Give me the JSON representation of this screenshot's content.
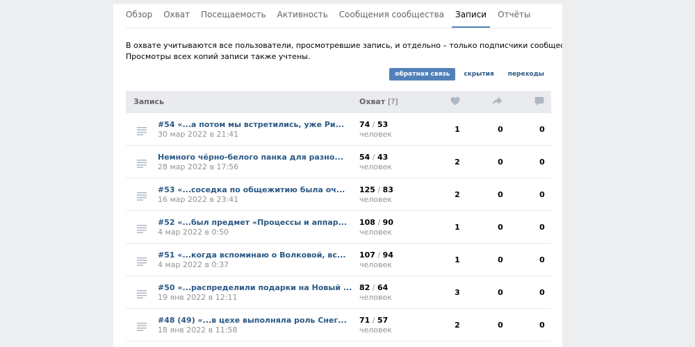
{
  "tabs": [
    {
      "label": "Обзор",
      "active": false
    },
    {
      "label": "Охват",
      "active": false
    },
    {
      "label": "Посещаемость",
      "active": false
    },
    {
      "label": "Активность",
      "active": false
    },
    {
      "label": "Сообщения сообщества",
      "active": false
    },
    {
      "label": "Записи",
      "active": true
    },
    {
      "label": "Отчёты",
      "active": false
    }
  ],
  "info": {
    "line1": "В охвате учитываются все пользователи, просмотревшие запись, и отдельно – только подписчики сообщества.",
    "line2": "Просмотры всех копий записи также учтены."
  },
  "switch": {
    "feedback": "обратная связь",
    "hides": "скрытия",
    "clicks": "переходы",
    "active": "feedback"
  },
  "table": {
    "col_post": "Запись",
    "col_reach": "Охват",
    "col_reach_hint": "[?]",
    "icons": [
      "heart-icon",
      "share-icon",
      "comment-icon"
    ],
    "unit": "человек",
    "rows": [
      {
        "title": "#54 «...а потом мы встретились, уже Ри...",
        "date": "30 мар 2022 в 21:41",
        "reach_total": "74",
        "reach_subs": "53",
        "likes": "1",
        "shares": "0",
        "comments": "0"
      },
      {
        "title": "Немного чёрно-белого панка для разно...",
        "date": "28 мар 2022 в 17:56",
        "reach_total": "54",
        "reach_subs": "43",
        "likes": "2",
        "shares": "0",
        "comments": "0"
      },
      {
        "title": "#53 «...соседка по общежитию была оч...",
        "date": "16 мар 2022 в 23:41",
        "reach_total": "125",
        "reach_subs": "83",
        "likes": "2",
        "shares": "0",
        "comments": "0"
      },
      {
        "title": "#52 «...был предмет «Процессы и аппар...",
        "date": "4 мар 2022 в 0:50",
        "reach_total": "108",
        "reach_subs": "90",
        "likes": "1",
        "shares": "0",
        "comments": "0"
      },
      {
        "title": "#51 «...когда вспоминаю о Волковой, вс...",
        "date": "4 мар 2022 в 0:37",
        "reach_total": "107",
        "reach_subs": "94",
        "likes": "1",
        "shares": "0",
        "comments": "0"
      },
      {
        "title": "#50 «...распределили подарки на Новый ...",
        "date": "19 янв 2022 в 12:11",
        "reach_total": "82",
        "reach_subs": "64",
        "likes": "3",
        "shares": "0",
        "comments": "0"
      },
      {
        "title": "#48 (49) «...в цехе выполняла роль Снег...",
        "date": "18 янв 2022 в 11:58",
        "reach_total": "71",
        "reach_subs": "57",
        "likes": "2",
        "shares": "0",
        "comments": "0"
      }
    ]
  },
  "colors": {
    "accent": "#5181b8",
    "link": "#2a5885",
    "muted": "#939393",
    "header_bg": "#e9ebee",
    "page_bg": "#edeef0",
    "icon": "#aeb7c2"
  }
}
